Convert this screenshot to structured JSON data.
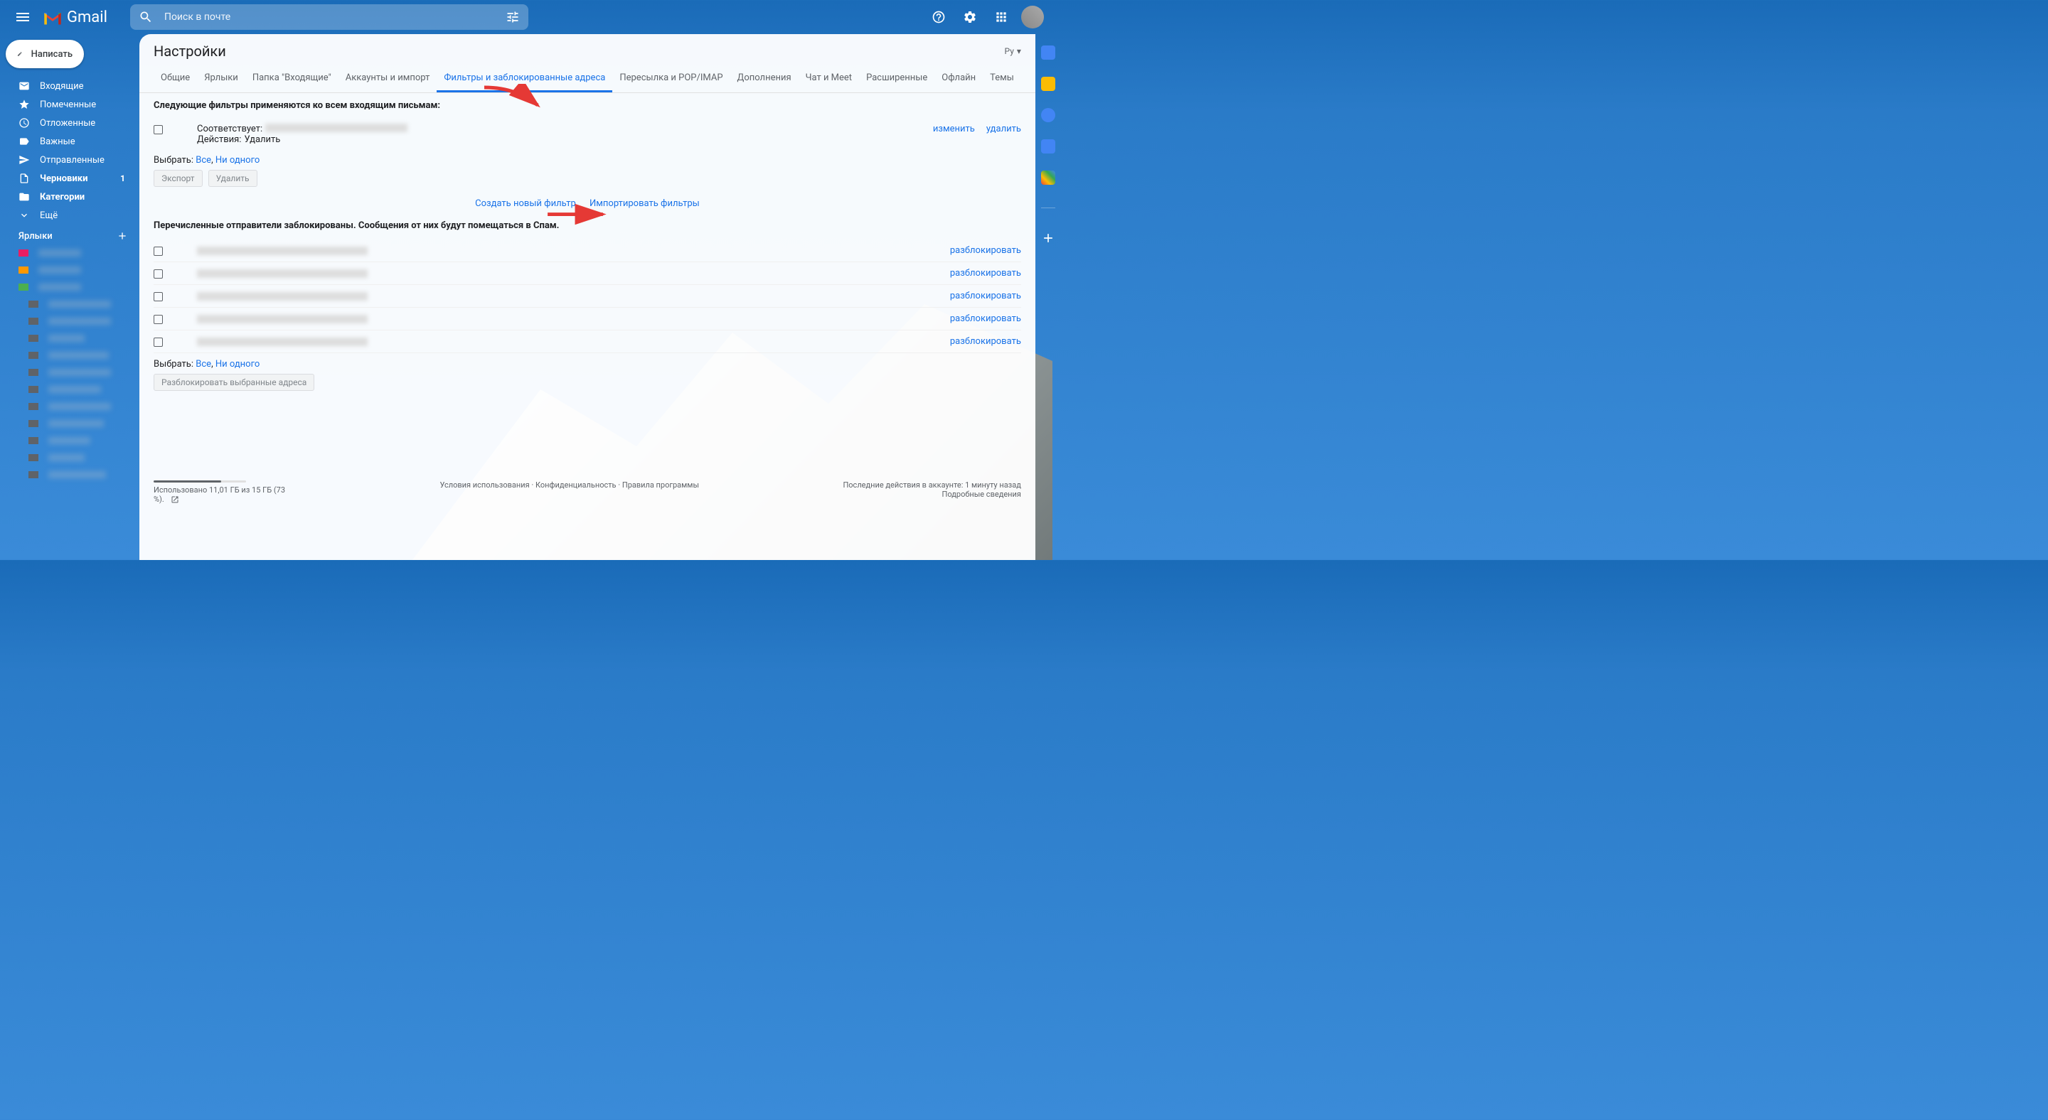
{
  "header": {
    "logo_text": "Gmail",
    "search_placeholder": "Поиск в почте"
  },
  "sidebar": {
    "compose": "Написать",
    "items": [
      {
        "label": "Входящие",
        "bold": false
      },
      {
        "label": "Помеченные",
        "bold": false
      },
      {
        "label": "Отложенные",
        "bold": false
      },
      {
        "label": "Важные",
        "bold": false
      },
      {
        "label": "Отправленные",
        "bold": false
      },
      {
        "label": "Черновики",
        "bold": true,
        "badge": "1"
      },
      {
        "label": "Категории",
        "bold": true
      },
      {
        "label": "Ещё",
        "bold": false
      }
    ],
    "labels_header": "Ярлыки"
  },
  "settings": {
    "title": "Настройки",
    "language_short": "Ру",
    "tabs": [
      "Общие",
      "Ярлыки",
      "Папка \"Входящие\"",
      "Аккаунты и импорт",
      "Фильтры и заблокированные адреса",
      "Пересылка и POP/IMAP",
      "Дополнения",
      "Чат и Meet",
      "Расширенные",
      "Офлайн",
      "Темы"
    ],
    "active_tab": 4,
    "filters_heading": "Следующие фильтры применяются ко всем входящим письмам:",
    "filter_matches_label": "Соответствует:",
    "filter_action_label": "Действия:",
    "filter_action_value": "Удалить",
    "edit": "изменить",
    "delete": "удалить",
    "select_label": "Выбрать:",
    "select_all": "Все",
    "select_none": "Ни одного",
    "export_btn": "Экспорт",
    "delete_btn": "Удалить",
    "create_filter": "Создать новый фильтр",
    "import_filters": "Импортировать фильтры",
    "blocked_heading": "Перечисленные отправители заблокированы. Сообщения от них будут помещаться в Спам.",
    "unblock": "разблокировать",
    "blocked_count": 5,
    "unblock_selected_btn": "Разблокировать выбранные адреса"
  },
  "footer": {
    "storage_text": "Использовано 11,01 ГБ из 15 ГБ (73 %).",
    "storage_percent": 73,
    "terms": "Условия использования",
    "privacy": "Конфиденциальность",
    "program": "Правила программы",
    "activity": "Последние действия в аккаунте: 1 минуту назад",
    "details": "Подробные сведения"
  }
}
